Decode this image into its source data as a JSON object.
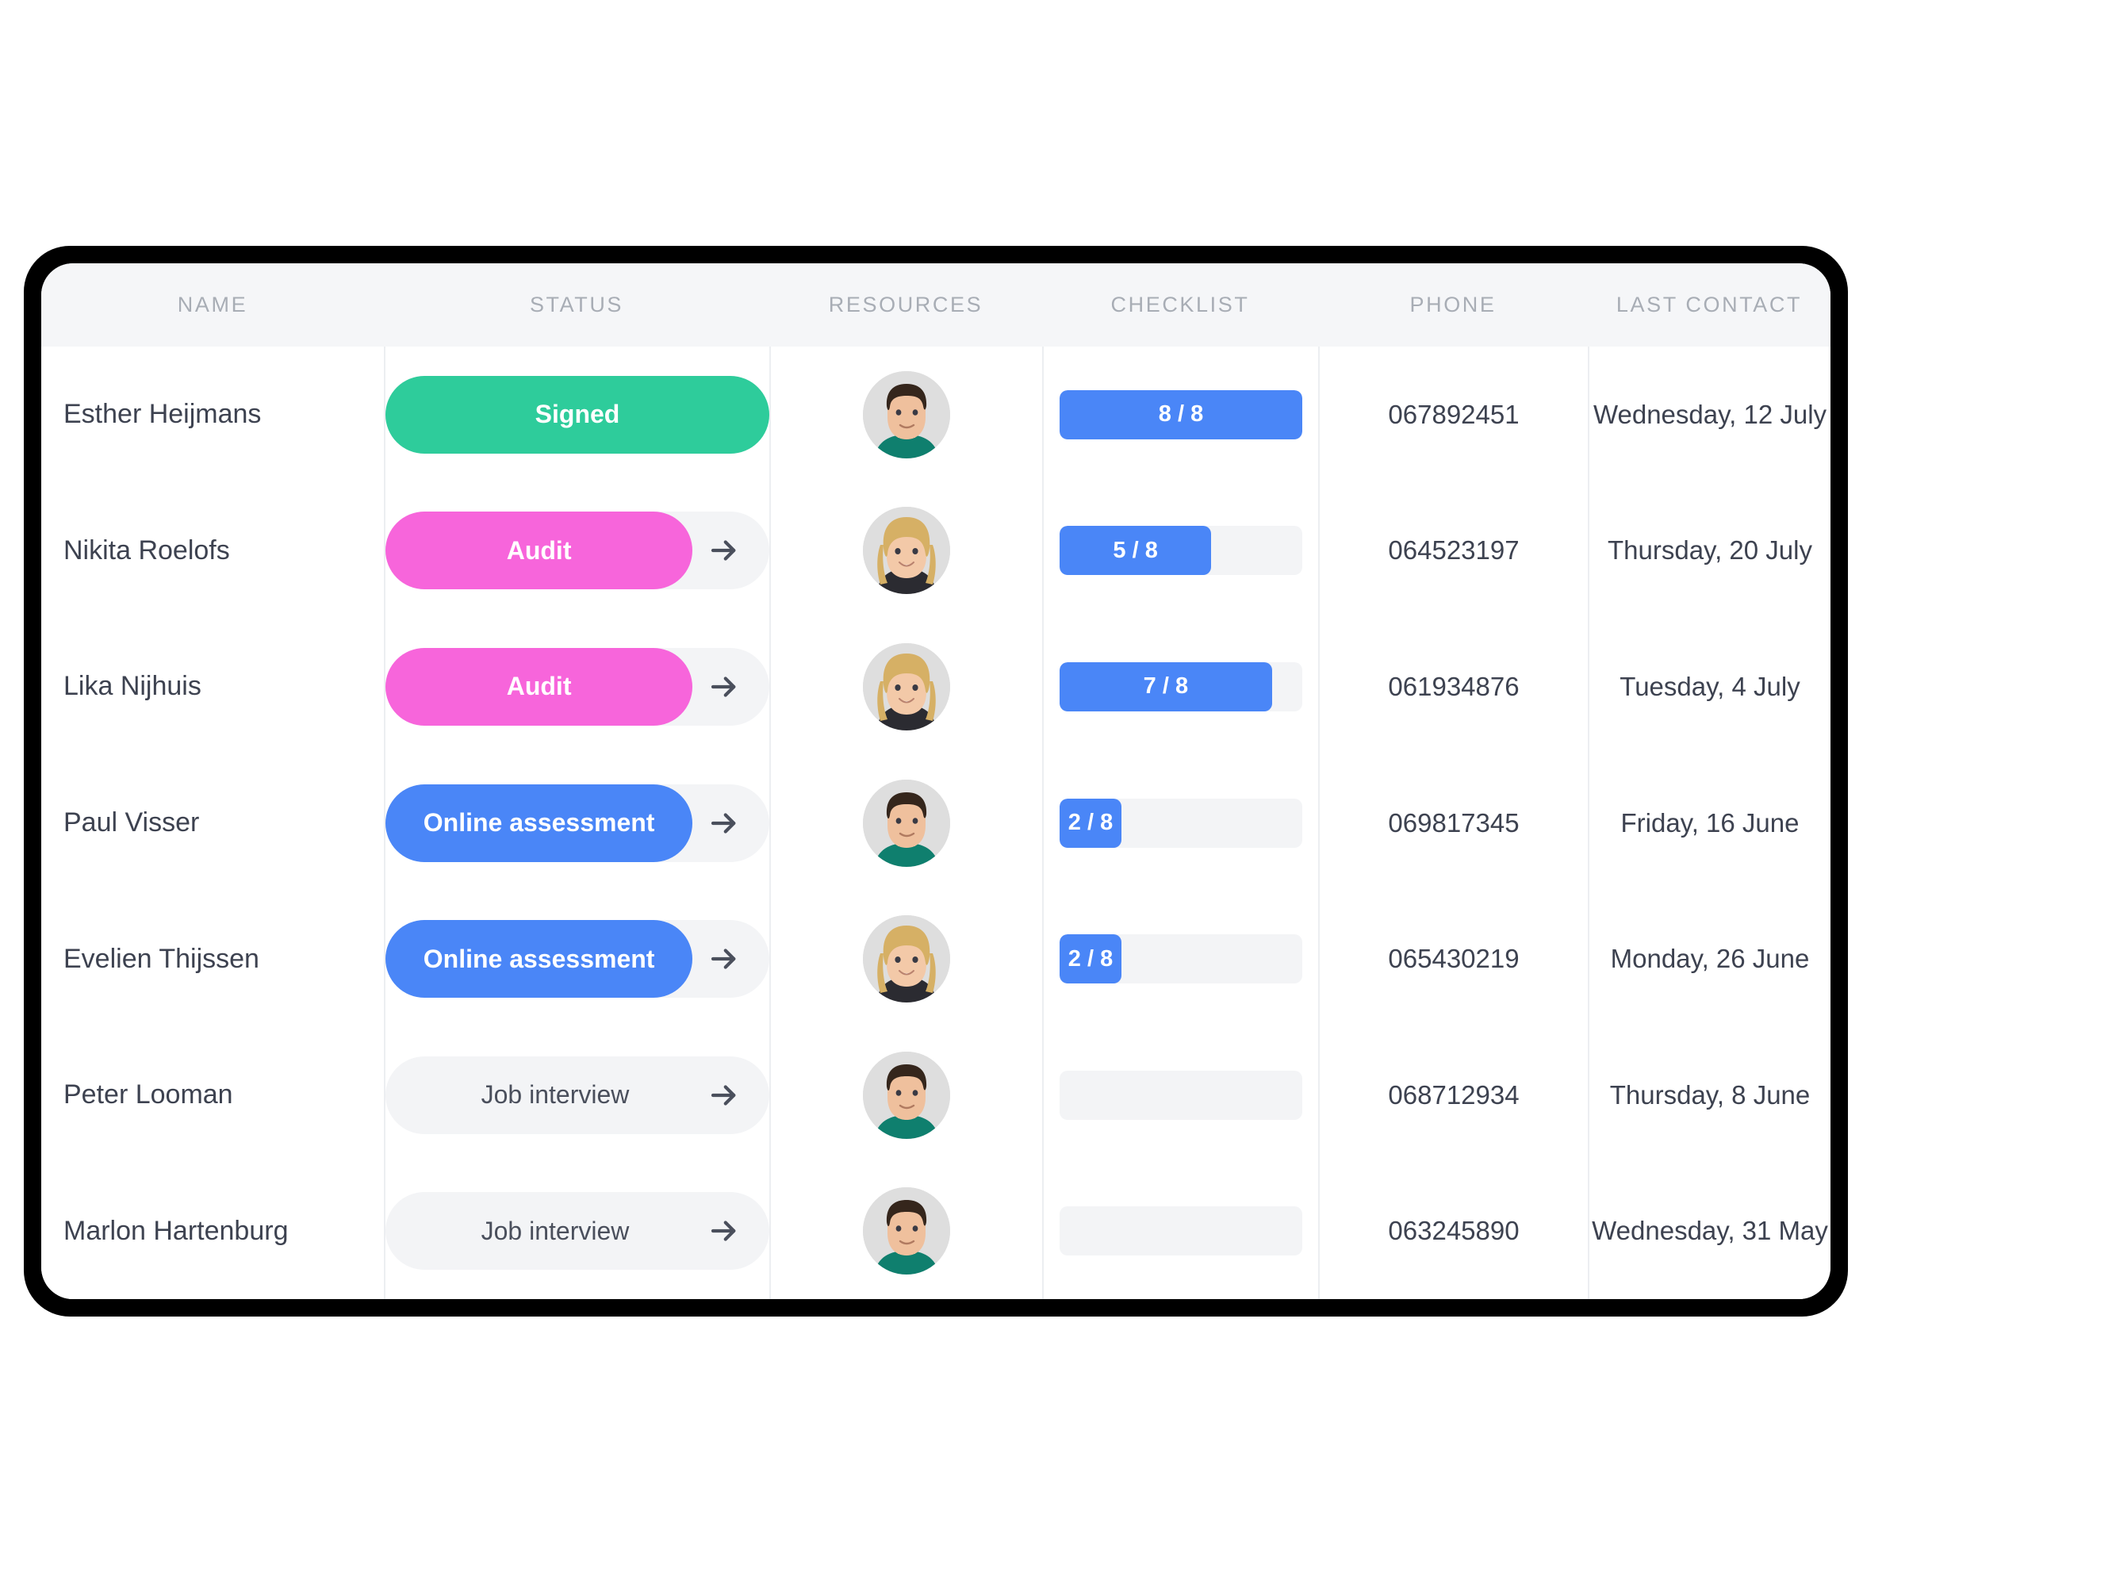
{
  "table": {
    "columns": [
      {
        "key": "name",
        "label": "NAME"
      },
      {
        "key": "status",
        "label": "STATUS"
      },
      {
        "key": "resources",
        "label": "RESOURCES"
      },
      {
        "key": "checklist",
        "label": "CHECKLIST"
      },
      {
        "key": "phone",
        "label": "PHONE"
      },
      {
        "key": "contact",
        "label": "LAST CONTACT"
      }
    ],
    "rows": [
      {
        "name": "Esther Heijmans",
        "status": {
          "label": "Signed",
          "fill_percent": 100,
          "color": "#2ecc9b",
          "has_arrow": false,
          "style": "filled"
        },
        "avatar": "male-avatar",
        "checklist": {
          "text": "8 / 8",
          "done": 8,
          "total": 8,
          "percent": 100
        },
        "phone": "067892451",
        "contact": "Wednesday, 12 July"
      },
      {
        "name": "Nikita Roelofs",
        "status": {
          "label": "Audit",
          "fill_percent": 80,
          "color": "#f765db",
          "has_arrow": true,
          "style": "filled"
        },
        "avatar": "female-avatar",
        "checklist": {
          "text": "5 / 8",
          "done": 5,
          "total": 8,
          "percent": 62.5
        },
        "phone": "064523197",
        "contact": "Thursday, 20 July"
      },
      {
        "name": "Lika Nijhuis",
        "status": {
          "label": "Audit",
          "fill_percent": 80,
          "color": "#f765db",
          "has_arrow": true,
          "style": "filled"
        },
        "avatar": "female-avatar",
        "checklist": {
          "text": "7 / 8",
          "done": 7,
          "total": 8,
          "percent": 87.5
        },
        "phone": "061934876",
        "contact": "Tuesday, 4 July"
      },
      {
        "name": "Paul Visser",
        "status": {
          "label": "Online assessment",
          "fill_percent": 80,
          "color": "#4a86f7",
          "has_arrow": true,
          "style": "filled"
        },
        "avatar": "male-avatar",
        "checklist": {
          "text": "2 / 8",
          "done": 2,
          "total": 8,
          "percent": 25
        },
        "phone": "069817345",
        "contact": "Friday, 16 June"
      },
      {
        "name": "Evelien Thijssen",
        "status": {
          "label": "Online assessment",
          "fill_percent": 80,
          "color": "#4a86f7",
          "has_arrow": true,
          "style": "filled"
        },
        "avatar": "female-avatar",
        "checklist": {
          "text": "2 / 8",
          "done": 2,
          "total": 8,
          "percent": 25
        },
        "phone": "065430219",
        "contact": "Monday, 26 June"
      },
      {
        "name": "Peter Looman",
        "status": {
          "label": "Job interview",
          "fill_percent": 0,
          "color": "#f3f4f6",
          "has_arrow": true,
          "style": "plain"
        },
        "avatar": "male-avatar",
        "checklist": {
          "text": "",
          "done": 0,
          "total": 8,
          "percent": 0
        },
        "phone": "068712934",
        "contact": "Thursday, 8 June"
      },
      {
        "name": "Marlon Hartenburg",
        "status": {
          "label": "Job interview",
          "fill_percent": 0,
          "color": "#f3f4f6",
          "has_arrow": true,
          "style": "plain"
        },
        "avatar": "male-avatar",
        "checklist": {
          "text": "",
          "done": 0,
          "total": 8,
          "percent": 0
        },
        "phone": "063245890",
        "contact": "Wednesday, 31 May"
      }
    ]
  },
  "theme": {
    "green": "#2ecc9b",
    "pink": "#f765db",
    "blue": "#4a86f7",
    "track": "#f3f4f6",
    "header_bg": "#f5f6f8",
    "text": "#3d4250",
    "header_text": "#a8adb5",
    "divider": "#eceef1",
    "frame": "#000000"
  },
  "icons": {
    "arrow_right": "arrow-right-icon"
  }
}
